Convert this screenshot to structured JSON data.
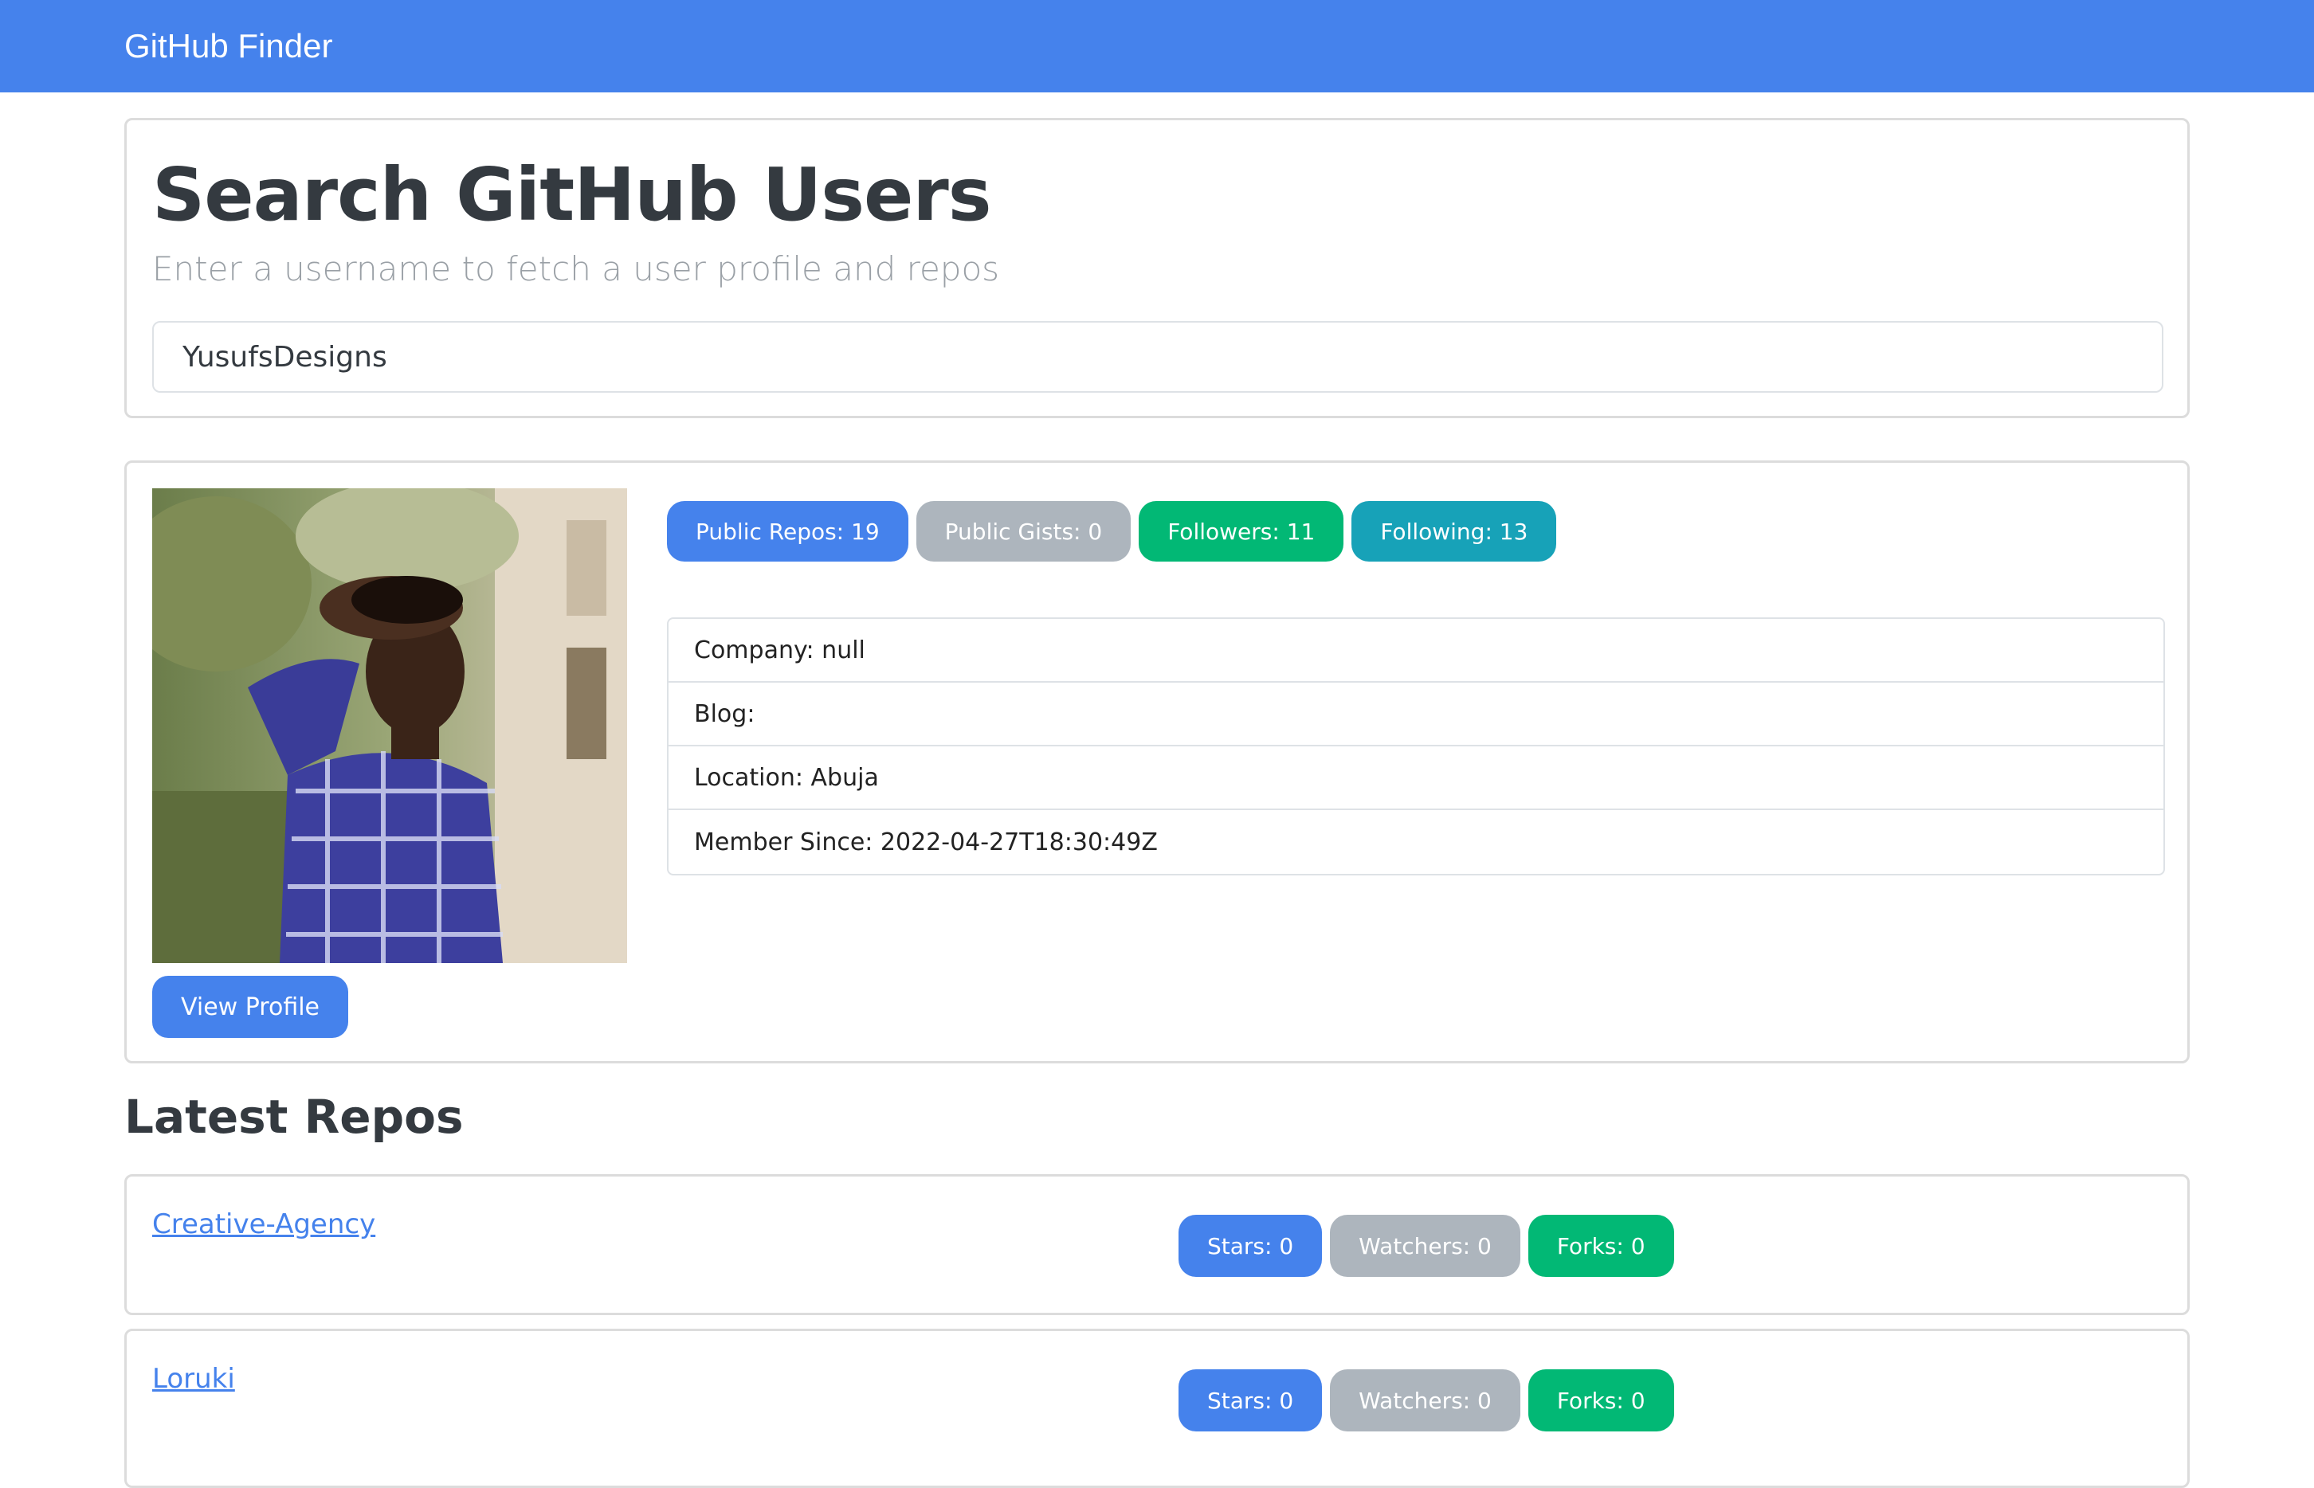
{
  "navbar": {
    "brand": "GitHub Finder"
  },
  "search": {
    "title": "Search GitHub Users",
    "subtitle": "Enter a username to fetch a user profile and repos",
    "value": "YusufsDesigns"
  },
  "profile": {
    "view_profile_label": "View Profile",
    "badges": [
      {
        "label": "Public Repos: 19",
        "color": "#4582ec"
      },
      {
        "label": "Public Gists: 0",
        "color": "#adb5bd"
      },
      {
        "label": "Followers: 11",
        "color": "#02b875"
      },
      {
        "label": "Following: 13",
        "color": "#17a2b8"
      }
    ],
    "info": [
      "Company: null",
      "Blog:",
      "Location: Abuja",
      "Member Since: 2022-04-27T18:30:49Z"
    ]
  },
  "repos": {
    "heading": "Latest Repos",
    "items": [
      {
        "name": "Creative-Agency",
        "stars": "Stars: 0",
        "watchers": "Watchers: 0",
        "forks": "Forks: 0"
      },
      {
        "name": "Loruki",
        "stars": "Stars: 0",
        "watchers": "Watchers: 0",
        "forks": "Forks: 0"
      }
    ]
  },
  "colors": {
    "primary": "#4582ec",
    "secondary": "#adb5bd",
    "success": "#02b875",
    "info": "#17a2b8"
  }
}
